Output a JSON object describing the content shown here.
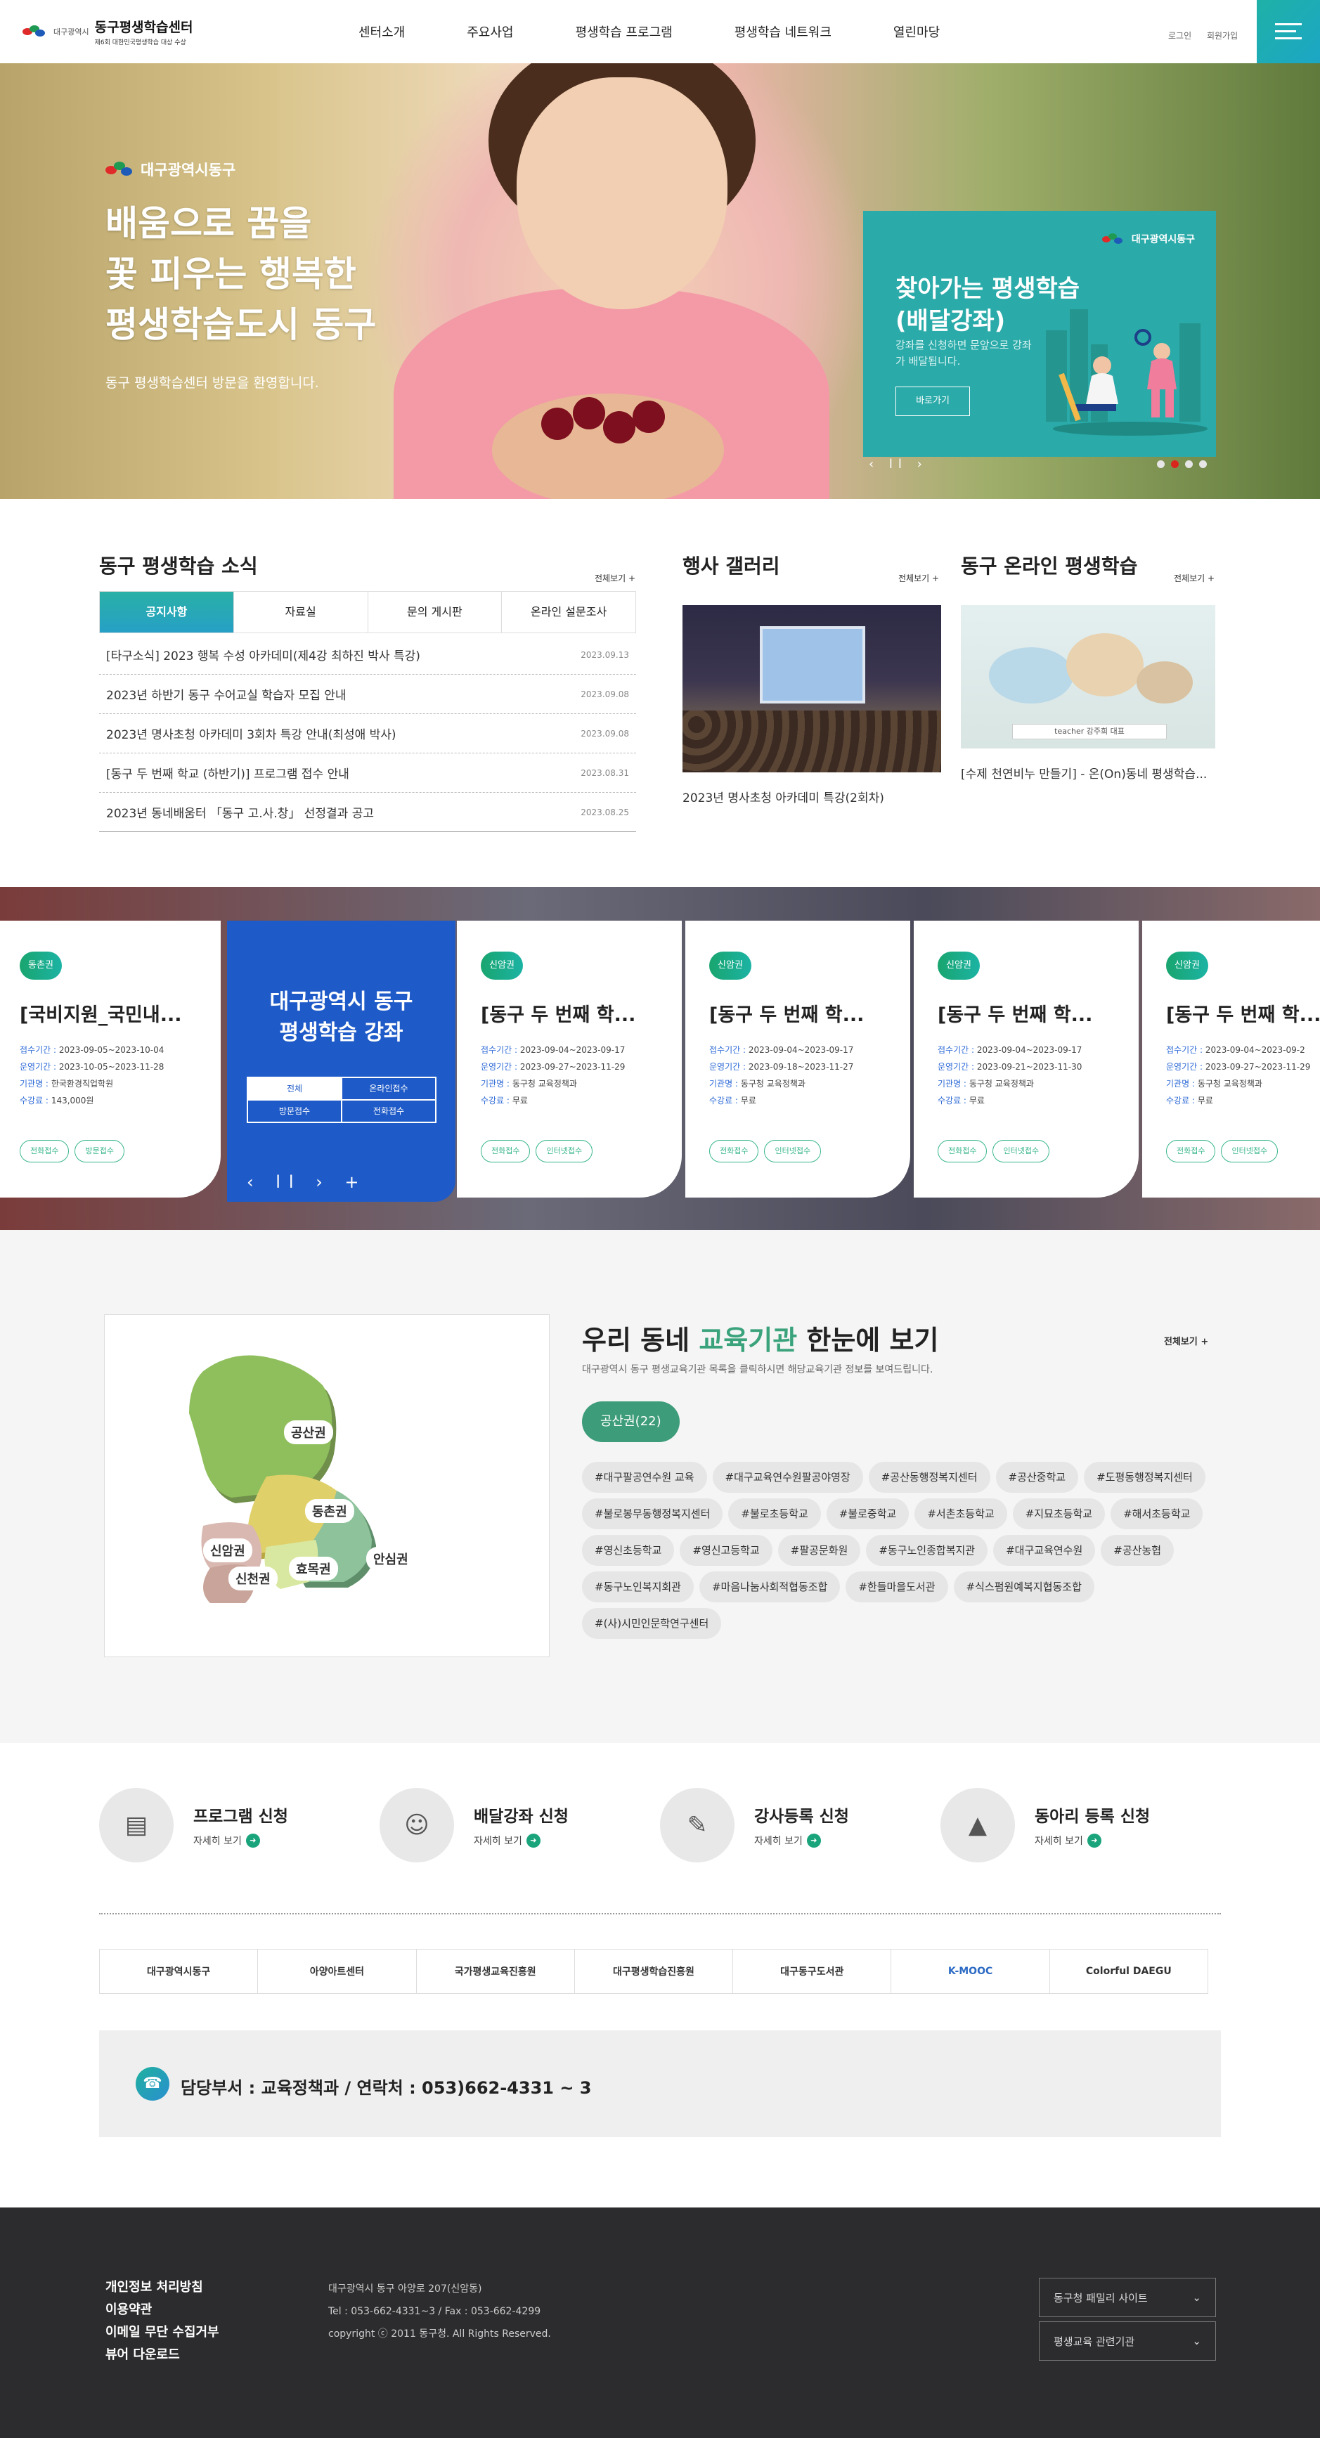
{
  "header": {
    "logo_sub": "대구광역시",
    "logo_main": "동구평생학습센터",
    "logo_tag": "제6회 대한민국평생학습 대상 수상",
    "nav": [
      "센터소개",
      "주요사업",
      "평생학습 프로그램",
      "평생학습 네트워크",
      "열린마당"
    ],
    "util": [
      "로그인",
      "회원가입"
    ]
  },
  "hero": {
    "brand": "대구광역시동구",
    "title_lines": [
      "배움으로 꿈을",
      "꽃 피우는 행복한",
      "평생학습도시 동구"
    ],
    "desc": "동구 평생학습센터 방문을 환영합니다.",
    "promo": {
      "brand": "대구광역시동구",
      "title_lines": [
        "찾아가는 평생학습",
        "(배달강좌)"
      ],
      "desc": "강좌를 신청하면 문앞으로 강좌가 배달됩니다.",
      "button": "바로가기"
    },
    "controls": "‹ ll ›"
  },
  "news": {
    "title": "동구 평생학습 소식",
    "more": "전체보기 +",
    "tabs": [
      "공지사항",
      "자료실",
      "문의 게시판",
      "온라인 설문조사"
    ],
    "items": [
      {
        "title": "[타구소식] 2023 행복 수성 아카데미(제4강 최하진 박사 특강)",
        "date": "2023.09.13"
      },
      {
        "title": "2023년 하반기 동구 수어교실 학습자 모집 안내",
        "date": "2023.09.08"
      },
      {
        "title": "2023년 명사초청 아카데미 3회차 특강 안내(최성애 박사)",
        "date": "2023.09.08"
      },
      {
        "title": "[동구 두 번째 학교 (하반기)] 프로그램 접수 안내",
        "date": "2023.08.31"
      },
      {
        "title": "2023년 동네배움터 「동구 고.사.창」 선정결과 공고",
        "date": "2023.08.25"
      }
    ]
  },
  "gallery": {
    "title": "행사 갤러리",
    "more": "전체보기 +",
    "caption": "2023년 명사초청 아카데미 특강(2회차)"
  },
  "online": {
    "title": "동구 온라인 평생학습",
    "more": "전체보기 +",
    "tag": "teacher  강주희 대표",
    "caption": "[수제 천연비누 만들기] - 온(On)동네 평생학습..."
  },
  "courses": {
    "feature": {
      "title_lines": [
        "대구광역시 동구",
        "평생학습 강좌"
      ],
      "filters": [
        "전체",
        "온라인접수",
        "방문접수",
        "전화접수"
      ],
      "controls": "‹ ll › +"
    },
    "meta_labels": [
      "접수기간 :",
      "운영기간 :",
      "기관명 :",
      "수강료 :"
    ],
    "cards": [
      {
        "badge": "동촌권",
        "title": "[국비지원_국민내...",
        "apply": "2023-09-05~2023-10-04",
        "run": "2023-10-05~2023-11-28",
        "org": "한국환경직업학원",
        "fee": "143,000원",
        "btns": [
          "전화접수",
          "방문접수"
        ]
      },
      {
        "badge": "신암권",
        "title": "[동구 두 번째 학...",
        "apply": "2023-09-04~2023-09-17",
        "run": "2023-09-27~2023-11-29",
        "org": "동구청 교육정책과",
        "fee": "무료",
        "btns": [
          "전화접수",
          "인터넷접수"
        ]
      },
      {
        "badge": "신암권",
        "title": "[동구 두 번째 학...",
        "apply": "2023-09-04~2023-09-17",
        "run": "2023-09-18~2023-11-27",
        "org": "동구청 교육정책과",
        "fee": "무료",
        "btns": [
          "전화접수",
          "인터넷접수"
        ]
      },
      {
        "badge": "신암권",
        "title": "[동구 두 번째 학...",
        "apply": "2023-09-04~2023-09-17",
        "run": "2023-09-21~2023-11-30",
        "org": "동구청 교육정책과",
        "fee": "무료",
        "btns": [
          "전화접수",
          "인터넷접수"
        ]
      },
      {
        "badge": "신암권",
        "title": "[동구 두 번째 학...",
        "apply": "2023-09-04~2023-09-2",
        "run": "2023-09-27~2023-11-29",
        "org": "동구청 교육정책과",
        "fee": "무료",
        "btns": [
          "전화접수",
          "인터넷접수"
        ]
      }
    ]
  },
  "map": {
    "title_pre": "우리 동네 ",
    "title_hl": "교육기관",
    "title_post": " 한눈에 보기",
    "desc": "대구광역시 동구 평생교육기관 목록을 클릭하시면 해당교육기관 정보를 보여드립니다.",
    "more": "전체보기 +",
    "regions": [
      "공산권",
      "동촌권",
      "신암권",
      "효목권",
      "안심권",
      "신천권"
    ],
    "selected": "공산권(22)",
    "tags": [
      "#대구팔공연수원 교육",
      "#대구교육연수원팔공야영장",
      "#공산동행정복지센터",
      "#공산중학교",
      "#도평동행정복지센터",
      "#불로봉무동행정복지센터",
      "#불로초등학교",
      "#불로중학교",
      "#서촌초등학교",
      "#지묘초등학교",
      "#해서초등학교",
      "#영신초등학교",
      "#영신고등학교",
      "#팔공문화원",
      "#동구노인종합복지관",
      "#대구교육연수원",
      "#공산농협",
      "#동구노인복지회관",
      "#마음나눔사회적협동조합",
      "#한들마을도서관",
      "#식스펌원예복지협동조합",
      "#(사)시민인문학연구센터"
    ]
  },
  "quick": [
    {
      "title": "프로그램 신청",
      "more": "자세히 보기"
    },
    {
      "title": "배달강좌 신청",
      "more": "자세히 보기"
    },
    {
      "title": "강사등록 신청",
      "more": "자세히 보기"
    },
    {
      "title": "동아리 등록 신청",
      "more": "자세히 보기"
    }
  ],
  "partners": [
    "대구광역시동구",
    "아양아트센터",
    "국가평생교육진흥원",
    "대구평생학습진흥원",
    "대구동구도서관",
    "K-MOOC",
    "Colorful DAEGU"
  ],
  "contact": "담당부서 : 교육정책과 / 연락처 : 053)662-4331 ~ 3",
  "footer": {
    "links": [
      "개인정보 처리방침",
      "이용약관",
      "이메일 무단 수집거부",
      "뷰어 다운로드"
    ],
    "address": "대구광역시 동구 아양로 207(신암동)",
    "tel": "Tel : 053-662-4331~3 / Fax : 053-662-4299",
    "copyright": "copyright ⓒ 2011 동구청. All Rights Reserved.",
    "selects": [
      "동구청 패밀리 사이트",
      "평생교육 관련기관"
    ]
  },
  "colors": {
    "accent": "#2ab0a6",
    "blue": "#1f5bc8",
    "green": "#3d9c7a",
    "footer": "#2c2c2e"
  }
}
